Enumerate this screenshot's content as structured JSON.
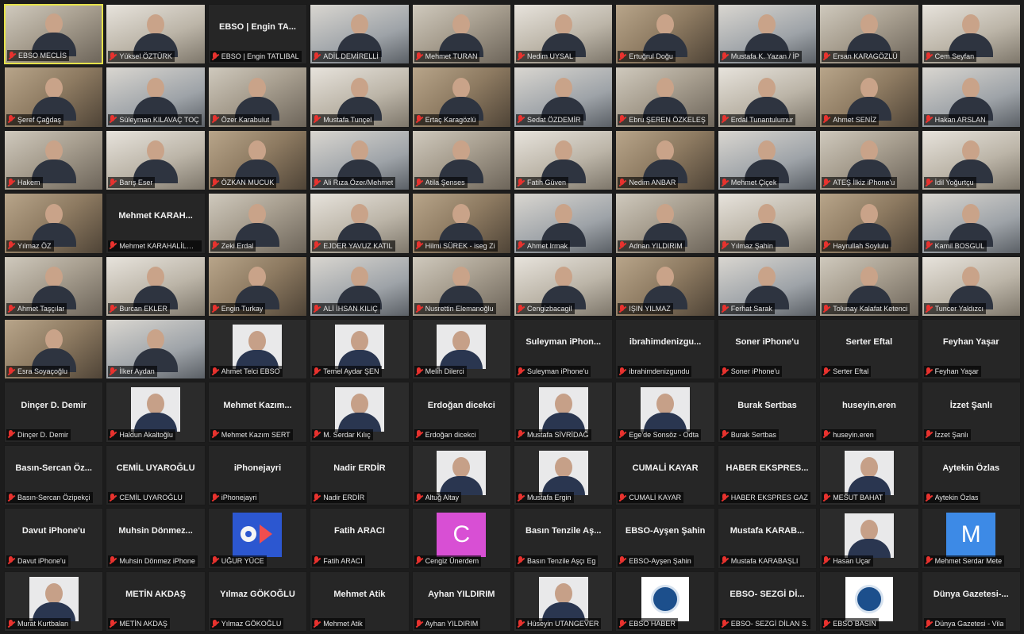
{
  "meeting": {
    "participants": [
      {
        "name": "EBSO MECLİS",
        "display": "video",
        "active": true
      },
      {
        "name": "Yüksel ÖZTÜRK",
        "display": "video"
      },
      {
        "name": "EBSO | Engin TATLIBAL",
        "display": "name",
        "heading": "EBSO | Engin TA..."
      },
      {
        "name": "ADİL DEMİRELLİ",
        "display": "video"
      },
      {
        "name": "Mehmet TURAN",
        "display": "video"
      },
      {
        "name": "Nedim UYSAL",
        "display": "video"
      },
      {
        "name": "Ertuğrul Doğu",
        "display": "video"
      },
      {
        "name": "Mustafa K. Yazan / İP",
        "display": "video"
      },
      {
        "name": "Ersan KARAGÖZLÜ",
        "display": "video"
      },
      {
        "name": "Cem Seyfan",
        "display": "video"
      },
      {
        "name": "Şeref Çağdaş",
        "display": "video"
      },
      {
        "name": "Süleyman KILAVAÇ TOÇ",
        "display": "video"
      },
      {
        "name": "Özer Karabulut",
        "display": "video"
      },
      {
        "name": "Mustafa Tunçel",
        "display": "video"
      },
      {
        "name": "Ertaç Karagözlü",
        "display": "video"
      },
      {
        "name": "Sedat ÖZDEMİR",
        "display": "video"
      },
      {
        "name": "Ebru ŞEREN ÖZKELEŞ",
        "display": "video"
      },
      {
        "name": "Erdal Tunantulumur",
        "display": "video"
      },
      {
        "name": "Ahmet SENİZ",
        "display": "video"
      },
      {
        "name": "Hakan ARSLAN",
        "display": "video"
      },
      {
        "name": "Hakem",
        "display": "video"
      },
      {
        "name": "Barış Eser",
        "display": "video"
      },
      {
        "name": "ÖZKAN MUCUK",
        "display": "video"
      },
      {
        "name": "Ali Rıza Özer/Mehmet",
        "display": "video"
      },
      {
        "name": "Atila Şenses",
        "display": "video"
      },
      {
        "name": "Fatih Güven",
        "display": "video"
      },
      {
        "name": "Nedim ANBAR",
        "display": "video"
      },
      {
        "name": "Mehmet Çiçek",
        "display": "video"
      },
      {
        "name": "ATEŞ İlkiz iPhone'u",
        "display": "video"
      },
      {
        "name": "İdil Yoğurtçu",
        "display": "video"
      },
      {
        "name": "Yılmaz ÖZ",
        "display": "video"
      },
      {
        "name": "Mehmet KARAHALİLOĞLU",
        "display": "name",
        "heading": "Mehmet KARAH..."
      },
      {
        "name": "Zeki Erdal",
        "display": "video"
      },
      {
        "name": "EJDER YAVUZ KATIL",
        "display": "video"
      },
      {
        "name": "Hilmi SÜREK - iseg Zi",
        "display": "video"
      },
      {
        "name": "Ahmet Irmak",
        "display": "video"
      },
      {
        "name": "Adnan YILDIRIM",
        "display": "video"
      },
      {
        "name": "Yılmaz Şahin",
        "display": "video"
      },
      {
        "name": "Hayrullah Soylulu",
        "display": "video"
      },
      {
        "name": "Kamil BOSGUL",
        "display": "video"
      },
      {
        "name": "Ahmet Taşçılar",
        "display": "video"
      },
      {
        "name": "Burcan EKLER",
        "display": "video"
      },
      {
        "name": "Engin Turkay",
        "display": "video"
      },
      {
        "name": "ALİ İHSAN KILIÇ",
        "display": "video"
      },
      {
        "name": "Nusrettin Elemanoğlu",
        "display": "video"
      },
      {
        "name": "Cengizbacagil",
        "display": "video"
      },
      {
        "name": "IŞIN YILMAZ",
        "display": "video"
      },
      {
        "name": "Ferhat Sarak",
        "display": "video"
      },
      {
        "name": "Tolunay Kalafat Ketenci",
        "display": "video"
      },
      {
        "name": "Tuncer Yaldızcı",
        "display": "video"
      },
      {
        "name": "Esra Soyaçoğlu",
        "display": "video"
      },
      {
        "name": "İlker Aydan",
        "display": "video"
      },
      {
        "name": "Ahmet Telci EBSO",
        "display": "photo"
      },
      {
        "name": "Temel Aydar ŞEN",
        "display": "photo"
      },
      {
        "name": "Melih Dilerci",
        "display": "photo"
      },
      {
        "name": "Suleyman iPhone'u",
        "display": "name",
        "heading": "Suleyman iPhon..."
      },
      {
        "name": "ibrahimdenizgundu",
        "display": "name",
        "heading": "ibrahimdenizgu..."
      },
      {
        "name": "Soner iPhone'u",
        "display": "name",
        "heading": "Soner iPhone'u"
      },
      {
        "name": "Serter Eftal",
        "display": "name",
        "heading": "Serter Eftal"
      },
      {
        "name": "Feyhan Yaşar",
        "display": "name",
        "heading": "Feyhan Yaşar"
      },
      {
        "name": "Dinçer D. Demir",
        "display": "name",
        "heading": "Dinçer D. Demir"
      },
      {
        "name": "Haldun Akaltoğlu",
        "display": "photo"
      },
      {
        "name": "Mehmet Kazım SERT",
        "display": "name",
        "heading": "Mehmet Kazım..."
      },
      {
        "name": "M. Serdar Kılıç",
        "display": "photo"
      },
      {
        "name": "Erdoğan dicekci",
        "display": "name",
        "heading": "Erdoğan dicekci"
      },
      {
        "name": "Mustafa SİVRİDAĞ",
        "display": "photo"
      },
      {
        "name": "Ege'de Sonsöz - Odta",
        "display": "photo"
      },
      {
        "name": "Burak Sertbas",
        "display": "name",
        "heading": "Burak Sertbas"
      },
      {
        "name": "huseyin.eren",
        "display": "name",
        "heading": "huseyin.eren"
      },
      {
        "name": "İzzet Şanlı",
        "display": "name",
        "heading": "İzzet Şanlı"
      },
      {
        "name": "Basın-Sercan Özipekçi",
        "display": "name",
        "heading": "Basın-Sercan Öz..."
      },
      {
        "name": "CEMİL UYAROĞLU",
        "display": "name",
        "heading": "CEMİL UYAROĞLU"
      },
      {
        "name": "iPhonejayri",
        "display": "name",
        "heading": "iPhonejayri"
      },
      {
        "name": "Nadir ERDİR",
        "display": "name",
        "heading": "Nadir ERDİR"
      },
      {
        "name": "Altuğ Altay",
        "display": "photo"
      },
      {
        "name": "Mustafa Ergin",
        "display": "photo"
      },
      {
        "name": "CUMALİ KAYAR",
        "display": "name",
        "heading": "CUMALİ KAYAR"
      },
      {
        "name": "HABER EKSPRES GAZ",
        "display": "name",
        "heading": "HABER EKSPRES..."
      },
      {
        "name": "MESUT BAHAT",
        "display": "photo"
      },
      {
        "name": "Aytekin Özlas",
        "display": "name",
        "heading": "Aytekin Özlas"
      },
      {
        "name": "Davut iPhone'u",
        "display": "name",
        "heading": "Davut iPhone'u"
      },
      {
        "name": "Muhsin Dönmez iPhone",
        "display": "name",
        "heading": "Muhsin Dönmez..."
      },
      {
        "name": "UĞUR YÜCE",
        "display": "logo-uyce"
      },
      {
        "name": "Fatih ARACI",
        "display": "name",
        "heading": "Fatih ARACI"
      },
      {
        "name": "Cengiz Ünerdem",
        "display": "avatar",
        "letter": "C",
        "color": "#d84fd4"
      },
      {
        "name": "Basın Tenzile Aşçı Eg",
        "display": "name",
        "heading": "Basın Tenzile Aş..."
      },
      {
        "name": "EBSO-Ayşen Şahin",
        "display": "name",
        "heading": "EBSO-Ayşen Şahin"
      },
      {
        "name": "Mustafa KARABAŞLI",
        "display": "name",
        "heading": "Mustafa KARAB..."
      },
      {
        "name": "Hasan Uçar",
        "display": "photo"
      },
      {
        "name": "Mehmet Serdar Mete",
        "display": "avatar",
        "letter": "M",
        "color": "#3d8ae6"
      },
      {
        "name": "Murat Kurtbalan",
        "display": "photo"
      },
      {
        "name": "METİN AKDAŞ",
        "display": "name",
        "heading": "METİN AKDAŞ"
      },
      {
        "name": "Yılmaz GÖKOĞLU",
        "display": "name",
        "heading": "Yılmaz GÖKOĞLU"
      },
      {
        "name": "Mehmet Atik",
        "display": "name",
        "heading": "Mehmet Atik"
      },
      {
        "name": "Ayhan YILDIRIM",
        "display": "name",
        "heading": "Ayhan YILDIRIM"
      },
      {
        "name": "Hüseyin UTANGEVER",
        "display": "photo"
      },
      {
        "name": "EBSO HABER",
        "display": "logo"
      },
      {
        "name": "EBSO- SEZGİ DİLAN S.",
        "display": "name",
        "heading": "EBSO- SEZGİ Dİ..."
      },
      {
        "name": "EBSO BASIN",
        "display": "logo"
      },
      {
        "name": "Dünya Gazetesi - Vila",
        "display": "name",
        "heading": "Dünya Gazetesi-..."
      }
    ]
  }
}
